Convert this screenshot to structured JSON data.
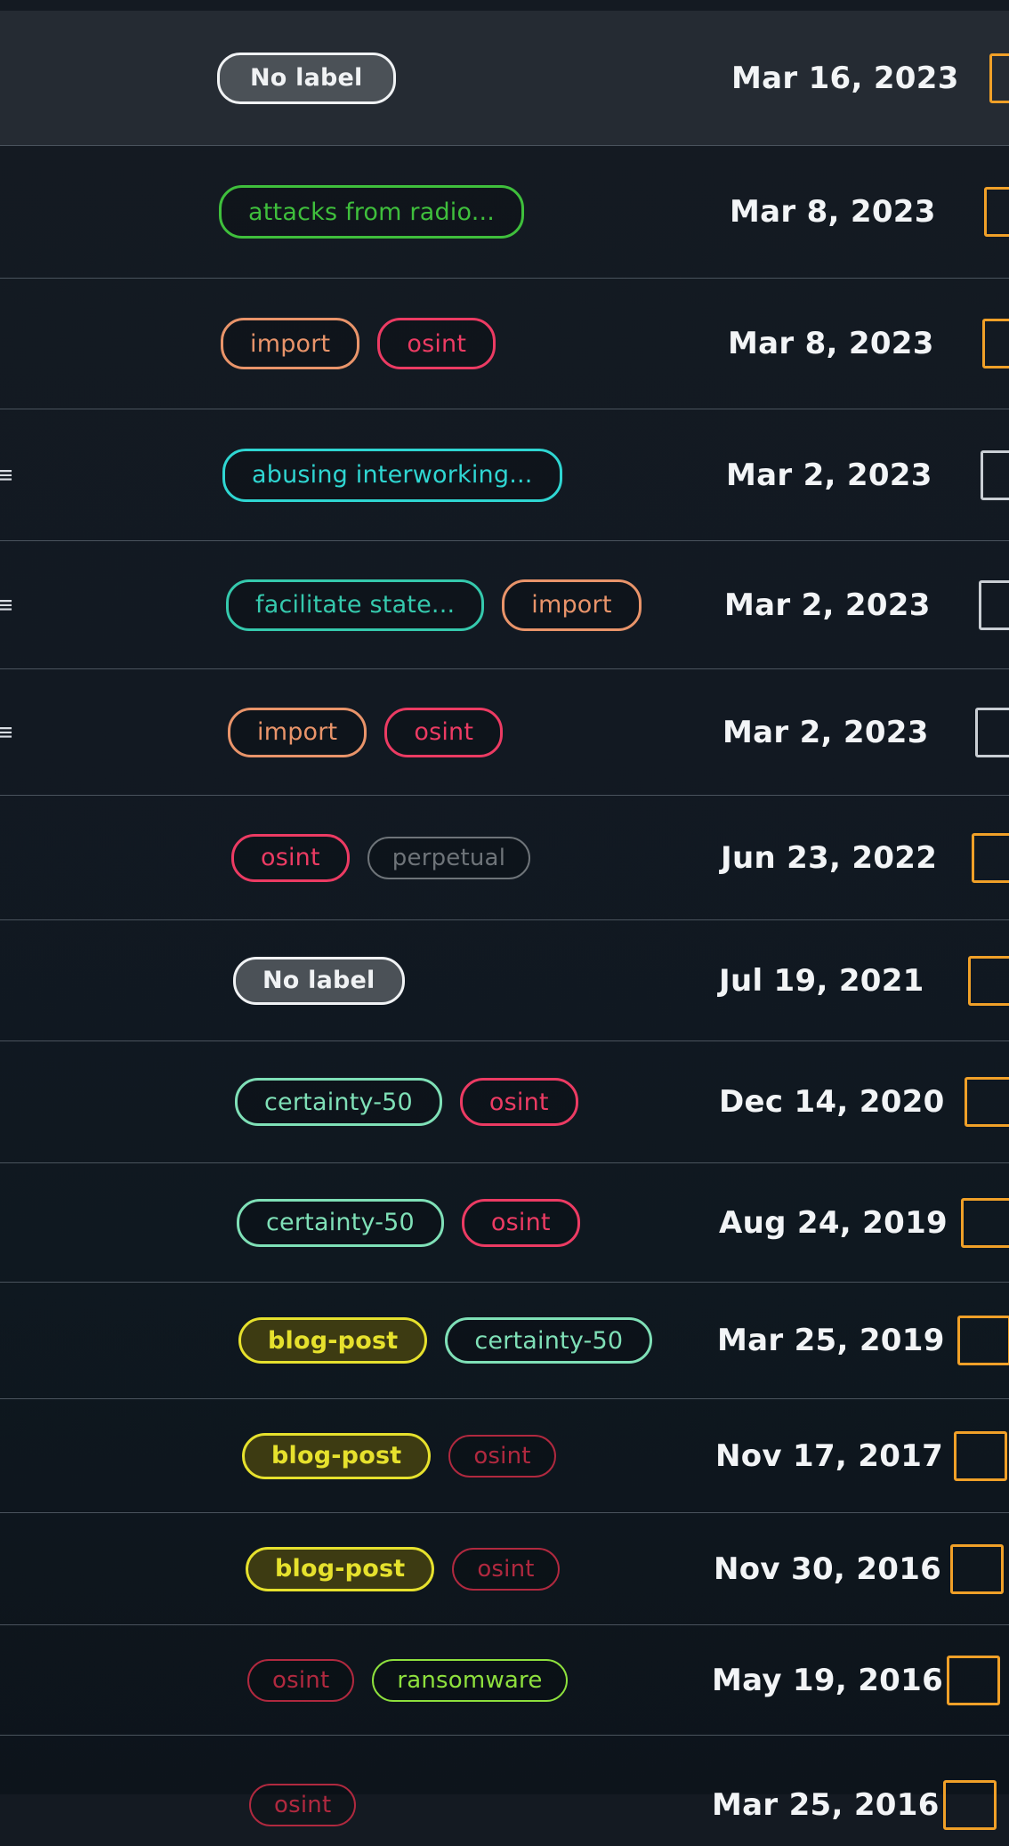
{
  "colors": {
    "default": "#e9ecef",
    "green": "#3fbf3c",
    "orange": "#e9946a",
    "red": "#ec3b63",
    "cyan": "#2fd6d2",
    "teal": "#35c9ad",
    "gray": "#6e7479",
    "mint": "#7fe0b7",
    "yellow": "#e6e12d",
    "lime": "#8ee03d",
    "dark_red": "#b0293f",
    "checkbox": "#f0a028"
  },
  "rows": [
    {
      "labels": [
        {
          "text": "No label",
          "color": "default"
        }
      ],
      "date": "Mar 16, 2023",
      "checkbox": "orange",
      "selected": true
    },
    {
      "labels": [
        {
          "text": "attacks from radio...",
          "color": "green"
        }
      ],
      "date": "Mar 8, 2023",
      "checkbox": "orange"
    },
    {
      "labels": [
        {
          "text": "import",
          "color": "orange"
        },
        {
          "text": "osint",
          "color": "red"
        }
      ],
      "date": "Mar 8, 2023",
      "checkbox": "orange"
    },
    {
      "labels": [
        {
          "text": "abusing interworking...",
          "color": "cyan"
        }
      ],
      "date": "Mar 2, 2023",
      "checkbox": "plain"
    },
    {
      "labels": [
        {
          "text": "facilitate state...",
          "color": "teal"
        },
        {
          "text": "import",
          "color": "orange"
        }
      ],
      "date": "Mar 2, 2023",
      "checkbox": "plain"
    },
    {
      "labels": [
        {
          "text": "import",
          "color": "orange"
        },
        {
          "text": "osint",
          "color": "red"
        }
      ],
      "date": "Mar 2, 2023",
      "checkbox": "plain"
    },
    {
      "labels": [
        {
          "text": "osint",
          "color": "red"
        },
        {
          "text": "perpetual",
          "color": "gray"
        }
      ],
      "date": "Jun 23, 2022",
      "checkbox": "orange"
    },
    {
      "labels": [
        {
          "text": "No label",
          "color": "default"
        }
      ],
      "date": "Jul 19, 2021",
      "checkbox": "orange"
    },
    {
      "labels": [
        {
          "text": "certainty-50",
          "color": "mint"
        },
        {
          "text": "osint",
          "color": "red"
        }
      ],
      "date": "Dec 14, 2020",
      "checkbox": "orange"
    },
    {
      "labels": [
        {
          "text": "certainty-50",
          "color": "mint"
        },
        {
          "text": "osint",
          "color": "red"
        }
      ],
      "date": "Aug 24, 2019",
      "checkbox": "orange"
    },
    {
      "labels": [
        {
          "text": "blog-post",
          "color": "yellow"
        },
        {
          "text": "certainty-50",
          "color": "mint"
        }
      ],
      "date": "Mar 25, 2019",
      "checkbox": "orange"
    },
    {
      "labels": [
        {
          "text": "blog-post",
          "color": "yellow"
        },
        {
          "text": "osint",
          "color": "dark_red"
        }
      ],
      "date": "Nov 17, 2017",
      "checkbox": "orange"
    },
    {
      "labels": [
        {
          "text": "blog-post",
          "color": "yellow"
        },
        {
          "text": "osint",
          "color": "dark_red"
        }
      ],
      "date": "Nov 30, 2016",
      "checkbox": "orange"
    },
    {
      "labels": [
        {
          "text": "osint",
          "color": "dark_red"
        },
        {
          "text": "ransomware",
          "color": "lime"
        }
      ],
      "date": "May 19, 2016",
      "checkbox": "orange"
    },
    {
      "labels": [
        {
          "text": "osint",
          "color": "dark_red"
        }
      ],
      "date": "Mar 25, 2016",
      "checkbox": "orange"
    }
  ]
}
